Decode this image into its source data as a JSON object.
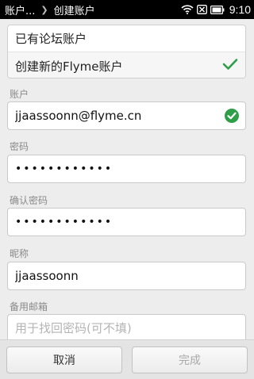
{
  "statusbar": {
    "breadcrumb_parent": "账户...",
    "breadcrumb_current": "创建账户",
    "time": "9:10",
    "icons": [
      "wifi-icon",
      "sim-blocked-icon",
      "battery-icon"
    ]
  },
  "account_choice": {
    "options": [
      {
        "label": "已有论坛账户",
        "selected": false
      },
      {
        "label": "创建新的Flyme账户",
        "selected": true
      }
    ]
  },
  "form": {
    "account": {
      "label": "账户",
      "value": "jjaassoonn@flyme.cn",
      "valid": true
    },
    "password": {
      "label": "密码",
      "value": "••••••••••••"
    },
    "confirm_password": {
      "label": "确认密码",
      "value": "••••••••••••"
    },
    "nickname": {
      "label": "昵称",
      "value": "jjaassoonn"
    },
    "backup_email": {
      "label": "备用邮箱",
      "placeholder": "用于找回密码(可不填)"
    }
  },
  "actions": {
    "cancel": "取消",
    "done": "完成"
  },
  "colors": {
    "accent_green": "#2e9e49",
    "status_bar": "#000000",
    "background": "#ededed"
  }
}
